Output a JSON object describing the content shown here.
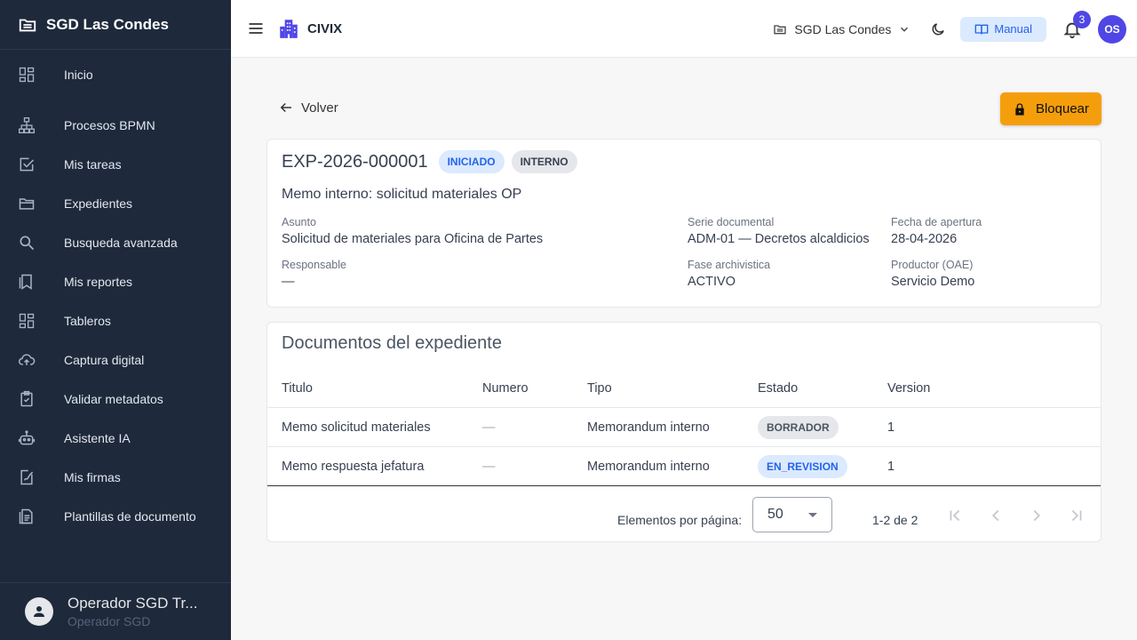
{
  "sidebar": {
    "title": "SGD Las Condes",
    "items": [
      {
        "label": "Inicio",
        "icon": "dashboard-icon"
      },
      {
        "label": "Procesos BPMN",
        "icon": "hierarchy-icon"
      },
      {
        "label": "Mis tareas",
        "icon": "checkbox-icon"
      },
      {
        "label": "Expedientes",
        "icon": "folder-open-icon"
      },
      {
        "label": "Busqueda avanzada",
        "icon": "search-icon"
      },
      {
        "label": "Mis reportes",
        "icon": "bookmark-doc-icon"
      },
      {
        "label": "Tableros",
        "icon": "dashboard-icon"
      },
      {
        "label": "Captura digital",
        "icon": "cloud-upload-icon"
      },
      {
        "label": "Validar metadatos",
        "icon": "clipboard-check-icon"
      },
      {
        "label": "Asistente IA",
        "icon": "robot-icon"
      },
      {
        "label": "Mis firmas",
        "icon": "signature-icon"
      },
      {
        "label": "Plantillas de documento",
        "icon": "document-icon"
      }
    ],
    "user": {
      "name": "Operador SGD Tr...",
      "role": "Operador SGD"
    }
  },
  "topbar": {
    "brand": "CIVIX",
    "org": "SGD Las Condes",
    "manual_label": "Manual",
    "notifications": "3",
    "avatar_initials": "OS"
  },
  "actions": {
    "back_label": "Volver",
    "lock_label": "Bloquear"
  },
  "expediente": {
    "id": "EXP-2026-000001",
    "status_chip": "INICIADO",
    "type_chip": "INTERNO",
    "title": "Memo interno: solicitud materiales OP",
    "fields": {
      "asunto": {
        "label": "Asunto",
        "value": "Solicitud de materiales para Oficina de Partes"
      },
      "serie": {
        "label": "Serie documental",
        "value": "ADM-01 — Decretos alcaldicios"
      },
      "fecha": {
        "label": "Fecha de apertura",
        "value": "28-04-2026"
      },
      "responsable": {
        "label": "Responsable",
        "value": "—"
      },
      "fase": {
        "label": "Fase archivistica",
        "value": "ACTIVO"
      },
      "productor": {
        "label": "Productor (OAE)",
        "value": "Servicio Demo"
      }
    }
  },
  "documents": {
    "title": "Documentos del expediente",
    "columns": [
      "Titulo",
      "Numero",
      "Tipo",
      "Estado",
      "Version"
    ],
    "rows": [
      {
        "titulo": "Memo solicitud materiales",
        "numero": "—",
        "tipo": "Memorandum interno",
        "estado": "BORRADOR",
        "version": "1"
      },
      {
        "titulo": "Memo respuesta jefatura",
        "numero": "—",
        "tipo": "Memorandum interno",
        "estado": "EN_REVISION",
        "version": "1"
      }
    ],
    "pager": {
      "label": "Elementos por página:",
      "page_size": "50",
      "range": "1-2 de 2"
    }
  }
}
